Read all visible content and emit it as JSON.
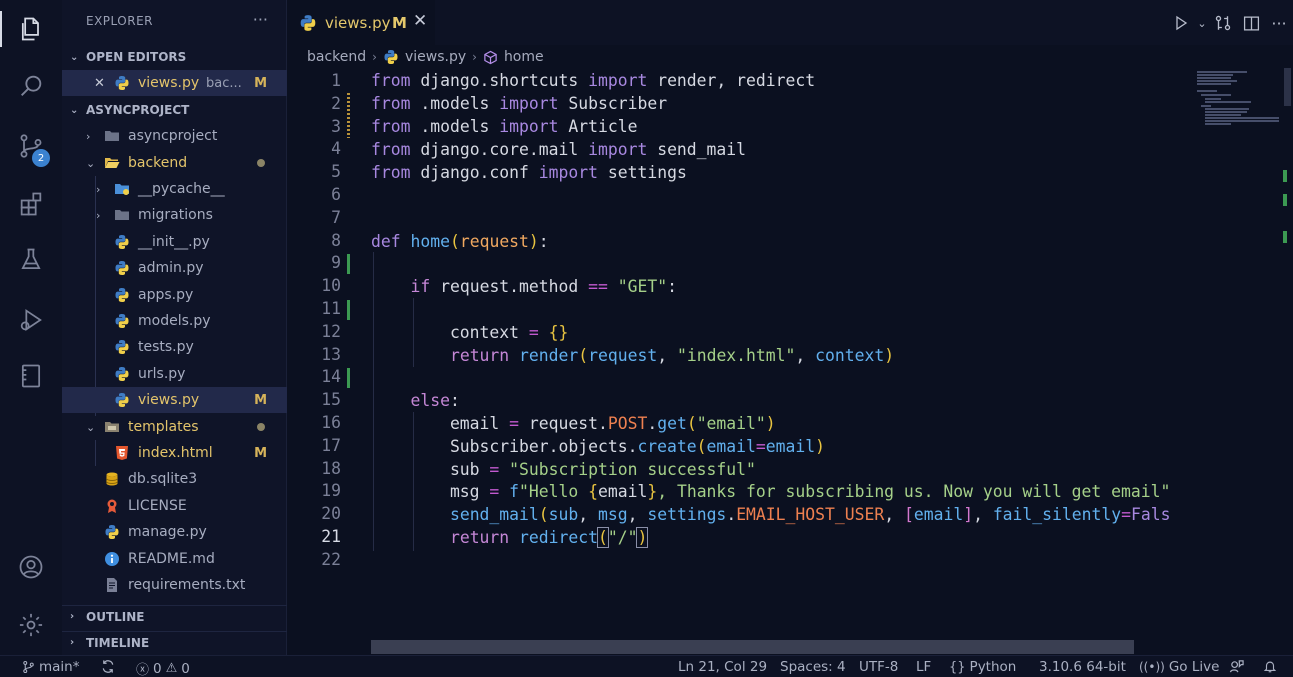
{
  "activity": {
    "items": [
      "explorer-icon",
      "search-icon",
      "source-control-icon",
      "extensions-icon",
      "testing-icon",
      "run-debug-icon",
      "notebook-icon"
    ],
    "scm_badge": "2",
    "bottom": [
      "account-icon",
      "settings-gear-icon"
    ]
  },
  "sidebar": {
    "title": "EXPLORER",
    "more": "···",
    "open_editors_label": "OPEN EDITORS",
    "open_editor": {
      "close": "✕",
      "name": "views.py",
      "path": "bac...",
      "mark": "M"
    },
    "project_label": "ASYNCPROJECT",
    "tree": [
      {
        "name": "asyncproject",
        "type": "folder"
      },
      {
        "name": "backend",
        "type": "folder-open"
      },
      {
        "name": "__pycache__",
        "type": "folder"
      },
      {
        "name": "migrations",
        "type": "folder"
      },
      {
        "name": "__init__.py",
        "type": "python"
      },
      {
        "name": "admin.py",
        "type": "python"
      },
      {
        "name": "apps.py",
        "type": "python"
      },
      {
        "name": "models.py",
        "type": "python"
      },
      {
        "name": "tests.py",
        "type": "python"
      },
      {
        "name": "urls.py",
        "type": "python"
      },
      {
        "name": "views.py",
        "type": "python",
        "mark": "M"
      },
      {
        "name": "templates",
        "type": "folder-open"
      },
      {
        "name": "index.html",
        "type": "html",
        "mark": "M"
      },
      {
        "name": "db.sqlite3",
        "type": "database"
      },
      {
        "name": "LICENSE",
        "type": "license"
      },
      {
        "name": "manage.py",
        "type": "python"
      },
      {
        "name": "README.md",
        "type": "info"
      },
      {
        "name": "requirements.txt",
        "type": "text"
      }
    ],
    "outline_label": "OUTLINE",
    "timeline_label": "TIMELINE"
  },
  "tab": {
    "name": "views.py",
    "mark": "M",
    "close": "✕"
  },
  "breadcrumb": {
    "folder": "backend",
    "file": "views.py",
    "symbol": "home",
    "sep": "›"
  },
  "editor": {
    "line_numbers": [
      "1",
      "2",
      "3",
      "4",
      "5",
      "6",
      "7",
      "8",
      "9",
      "10",
      "11",
      "12",
      "13",
      "14",
      "15",
      "16",
      "17",
      "18",
      "19",
      "20",
      "21",
      "22"
    ],
    "current_line": "21"
  },
  "colors": {
    "background": "#0b1020",
    "accent": "#e3c46b",
    "added": "#3c9a52",
    "keyword": "#a888e0",
    "string": "#a5d089"
  },
  "status": {
    "branch": "main*",
    "errors": "0",
    "warnings": "0",
    "position": "Ln 21, Col 29",
    "spaces": "Spaces: 4",
    "encoding": "UTF-8",
    "eol": "LF",
    "language": "Python",
    "interpreter": "3.10.6 64-bit",
    "live": "Go Live"
  }
}
